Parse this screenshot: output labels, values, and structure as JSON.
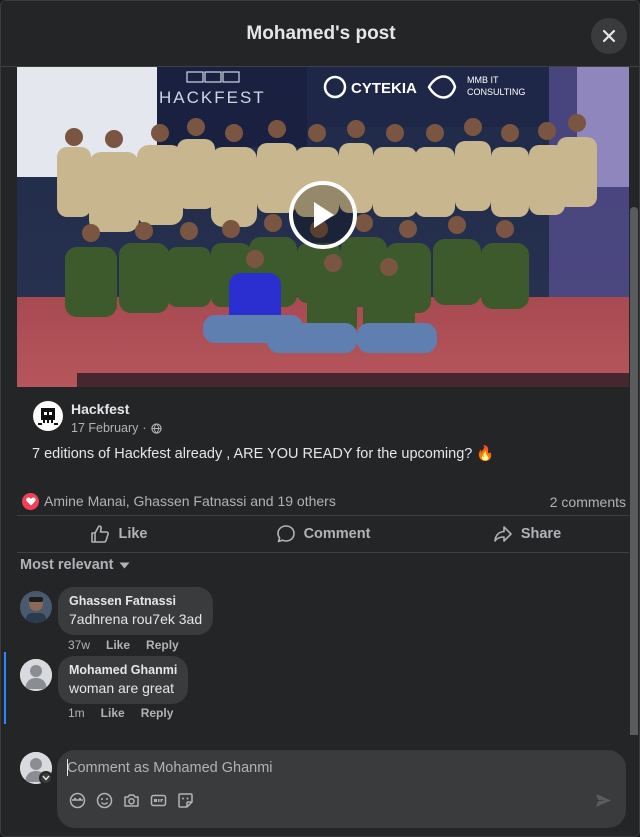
{
  "header": {
    "title": "Mohamed's post"
  },
  "media": {
    "banner_left": "HACKFEST",
    "banner_brand1": "CYTEKIA",
    "banner_brand2_line1": "MMB IT",
    "banner_brand2_line2": "CONSULTING"
  },
  "post": {
    "author": "Hackfest",
    "date": "17 February",
    "text": "7 editions of Hackfest already , ARE YOU READY for the upcoming? 🔥"
  },
  "reactions": {
    "names": "Amine Manai, Ghassen Fatnassi and 19 others",
    "comments_count": "2 comments"
  },
  "actions": {
    "like": "Like",
    "comment": "Comment",
    "share": "Share"
  },
  "sort": {
    "label": "Most relevant"
  },
  "comments": [
    {
      "author": "Ghassen Fatnassi",
      "text": "7adhrena rou7ek 3ad",
      "time": "37w",
      "like": "Like",
      "reply": "Reply"
    },
    {
      "author": "Mohamed Ghanmi",
      "text": "woman are great",
      "time": "1m",
      "like": "Like",
      "reply": "Reply"
    }
  ],
  "composer": {
    "placeholder": "Comment as Mohamed Ghanmi"
  },
  "colors": {
    "background": "#242526",
    "bubble": "#3a3b3c",
    "accent": "#2d88ff",
    "love": "#f33e58"
  }
}
